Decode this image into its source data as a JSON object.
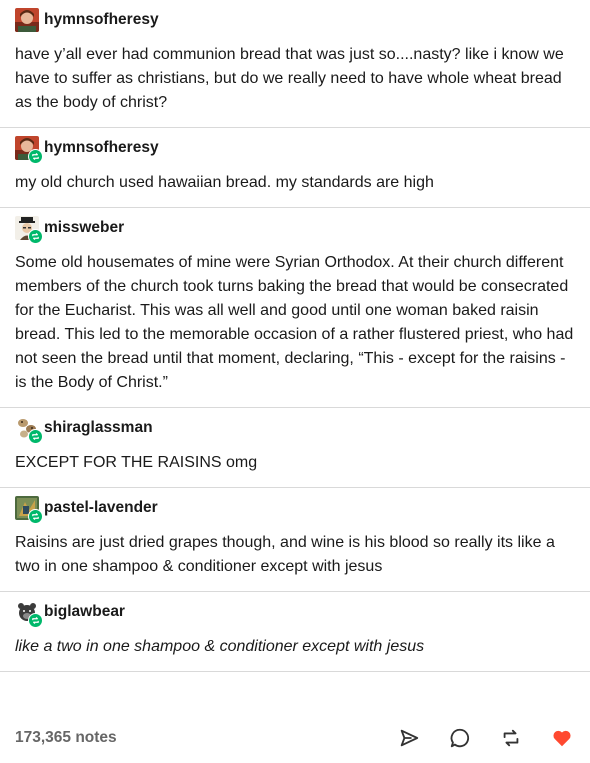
{
  "entries": [
    {
      "username": "hymnsofheresy",
      "avatar_icon": "profile-avatar-icon",
      "reblog": false,
      "body": "have y’all ever had communion bread that was just so....nasty? like i know we have to suffer as christians, but do we really need to have whole wheat bread as the body of christ?",
      "italic": false
    },
    {
      "username": "hymnsofheresy",
      "avatar_icon": "profile-avatar-icon",
      "reblog": true,
      "body": "my old church used hawaiian bread. my standards are high",
      "italic": false
    },
    {
      "username": "missweber",
      "avatar_icon": "profile-avatar-icon",
      "reblog": true,
      "body": "Some old housemates of mine were Syrian Orthodox. At their church different members of the church took turns baking the bread that would be consecrated for the Eucharist. This was all well and good until one woman baked raisin bread. This led to the memorable occasion of a rather flustered priest, who had not seen the bread until that moment, declaring, “This - except for the raisins - is the Body of Christ.”",
      "italic": false
    },
    {
      "username": "shiraglassman",
      "avatar_icon": "profile-avatar-icon",
      "reblog": true,
      "body": "EXCEPT FOR THE RAISINS omg",
      "italic": false
    },
    {
      "username": "pastel-lavender",
      "avatar_icon": "profile-avatar-icon",
      "reblog": true,
      "body": "Raisins are just dried grapes though, and wine is his blood so really its like a two in one shampoo & conditioner except with jesus",
      "italic": false
    },
    {
      "username": "biglawbear",
      "avatar_icon": "profile-avatar-icon",
      "reblog": true,
      "body": "like a two in one shampoo & conditioner except with jesus",
      "italic": true
    }
  ],
  "footer": {
    "notes": "173,365 notes",
    "actions": [
      "share-icon",
      "reply-icon",
      "reblog-icon",
      "like-icon"
    ]
  },
  "colors": {
    "reblog_badge": "#00b86b",
    "like_heart": "#ff4930",
    "divider": "#d9d9d9",
    "notes_text": "#666666"
  }
}
